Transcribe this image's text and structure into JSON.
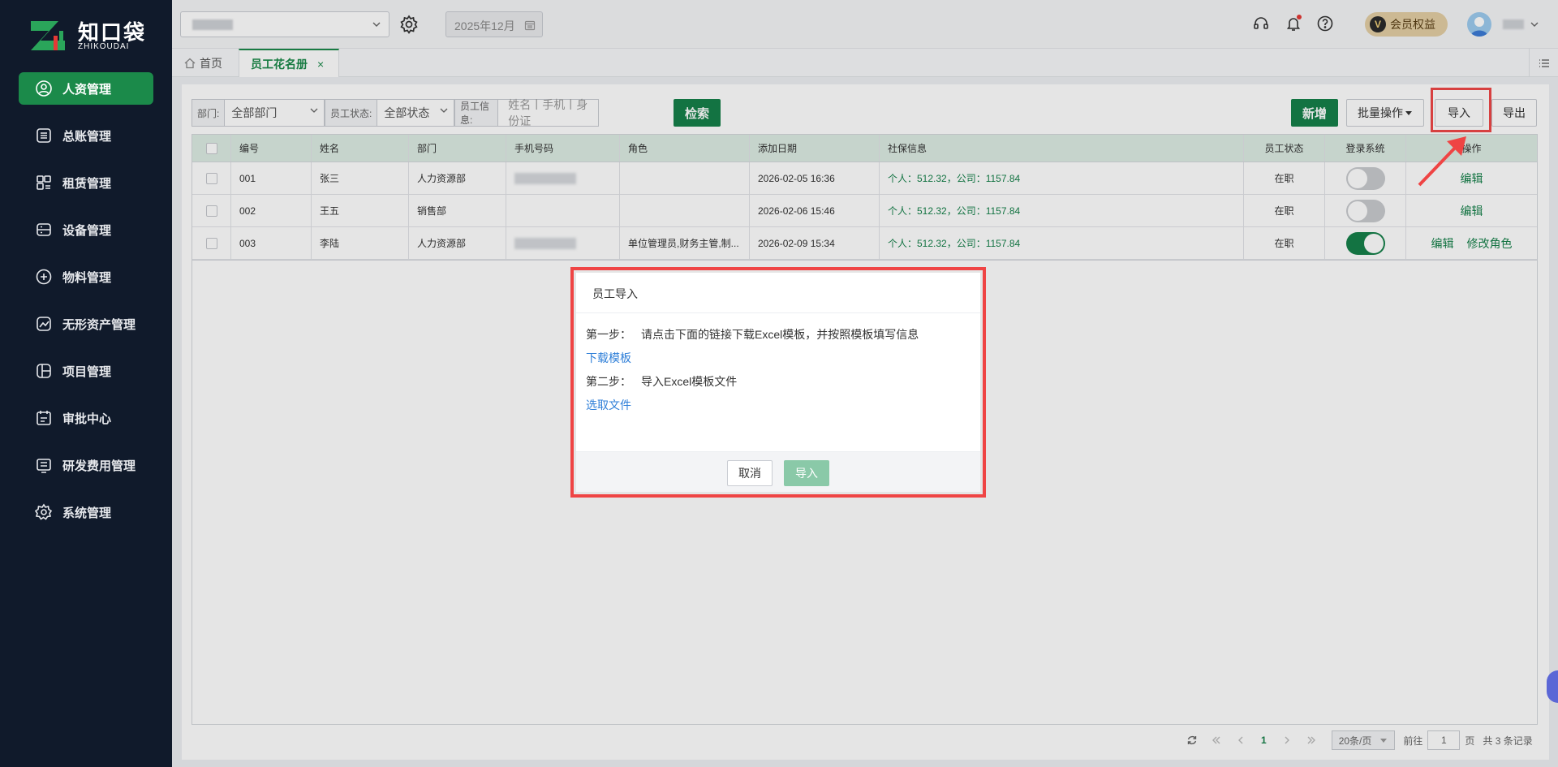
{
  "brand": {
    "title": "知口袋",
    "subtitle": "ZHIKOUDAI"
  },
  "sidebar": {
    "items": [
      {
        "label": "人资管理",
        "icon": "user-circle-icon",
        "active": true
      },
      {
        "label": "总账管理",
        "icon": "ledger-icon"
      },
      {
        "label": "租赁管理",
        "icon": "lease-icon"
      },
      {
        "label": "设备管理",
        "icon": "device-icon"
      },
      {
        "label": "物料管理",
        "icon": "material-icon"
      },
      {
        "label": "无形资产管理",
        "icon": "intangible-asset-icon"
      },
      {
        "label": "项目管理",
        "icon": "project-icon"
      },
      {
        "label": "审批中心",
        "icon": "approval-icon"
      },
      {
        "label": "研发费用管理",
        "icon": "rd-expense-icon"
      },
      {
        "label": "系统管理",
        "icon": "settings-icon"
      }
    ]
  },
  "topbar": {
    "date": "2025年12月",
    "member_label": "会员权益",
    "member_badge": "V"
  },
  "tabs": {
    "home": "首页",
    "active": "员工花名册",
    "close": "×"
  },
  "filters": {
    "dept_label": "部门:",
    "dept_value": "全部部门",
    "status_label": "员工状态:",
    "status_value": "全部状态",
    "info_label": "员工信息:",
    "info_placeholder": "姓名丨手机丨身份证",
    "search_button": "检索"
  },
  "actions": {
    "add": "新增",
    "batch": "批量操作",
    "import": "导入",
    "export": "导出"
  },
  "table": {
    "columns": [
      "编号",
      "姓名",
      "部门",
      "手机号码",
      "角色",
      "添加日期",
      "社保信息",
      "员工状态",
      "登录系统",
      "操作"
    ],
    "rows": [
      {
        "id": "001",
        "name": "张三",
        "dept": "人力资源部",
        "role": "",
        "date": "2026-02-05 16:36",
        "social": "个人：512.32，公司：1157.84",
        "status": "在职",
        "login": false,
        "ops": [
          "编辑"
        ]
      },
      {
        "id": "002",
        "name": "王五",
        "dept": "销售部",
        "role": "",
        "date": "2026-02-06 15:46",
        "social": "个人：512.32，公司：1157.84",
        "status": "在职",
        "login": false,
        "ops": [
          "编辑"
        ]
      },
      {
        "id": "003",
        "name": "李陆",
        "dept": "人力资源部",
        "role": "单位管理员,财务主管,制...",
        "date": "2026-02-09 15:34",
        "social": "个人：512.32，公司：1157.84",
        "status": "在职",
        "login": true,
        "ops": [
          "编辑",
          "修改角色"
        ]
      }
    ]
  },
  "pagination": {
    "current": "1",
    "page_size": "20条/页",
    "goto_prefix": "前往",
    "goto_value": "1",
    "goto_suffix": "页",
    "total": "共 3 条记录"
  },
  "modal": {
    "title": "员工导入",
    "step1_label": "第一步：",
    "step1_text": "请点击下面的链接下载Excel模板，并按照模板填写信息",
    "download_link": "下载模板",
    "step2_label": "第二步：",
    "step2_text": "导入Excel模板文件",
    "select_link": "选取文件",
    "cancel": "取消",
    "confirm": "导入"
  },
  "colors": {
    "sidebar_bg": "#101a2b",
    "accent": "#16814a",
    "highlight": "#ef4444",
    "link": "#2f7fd8"
  }
}
